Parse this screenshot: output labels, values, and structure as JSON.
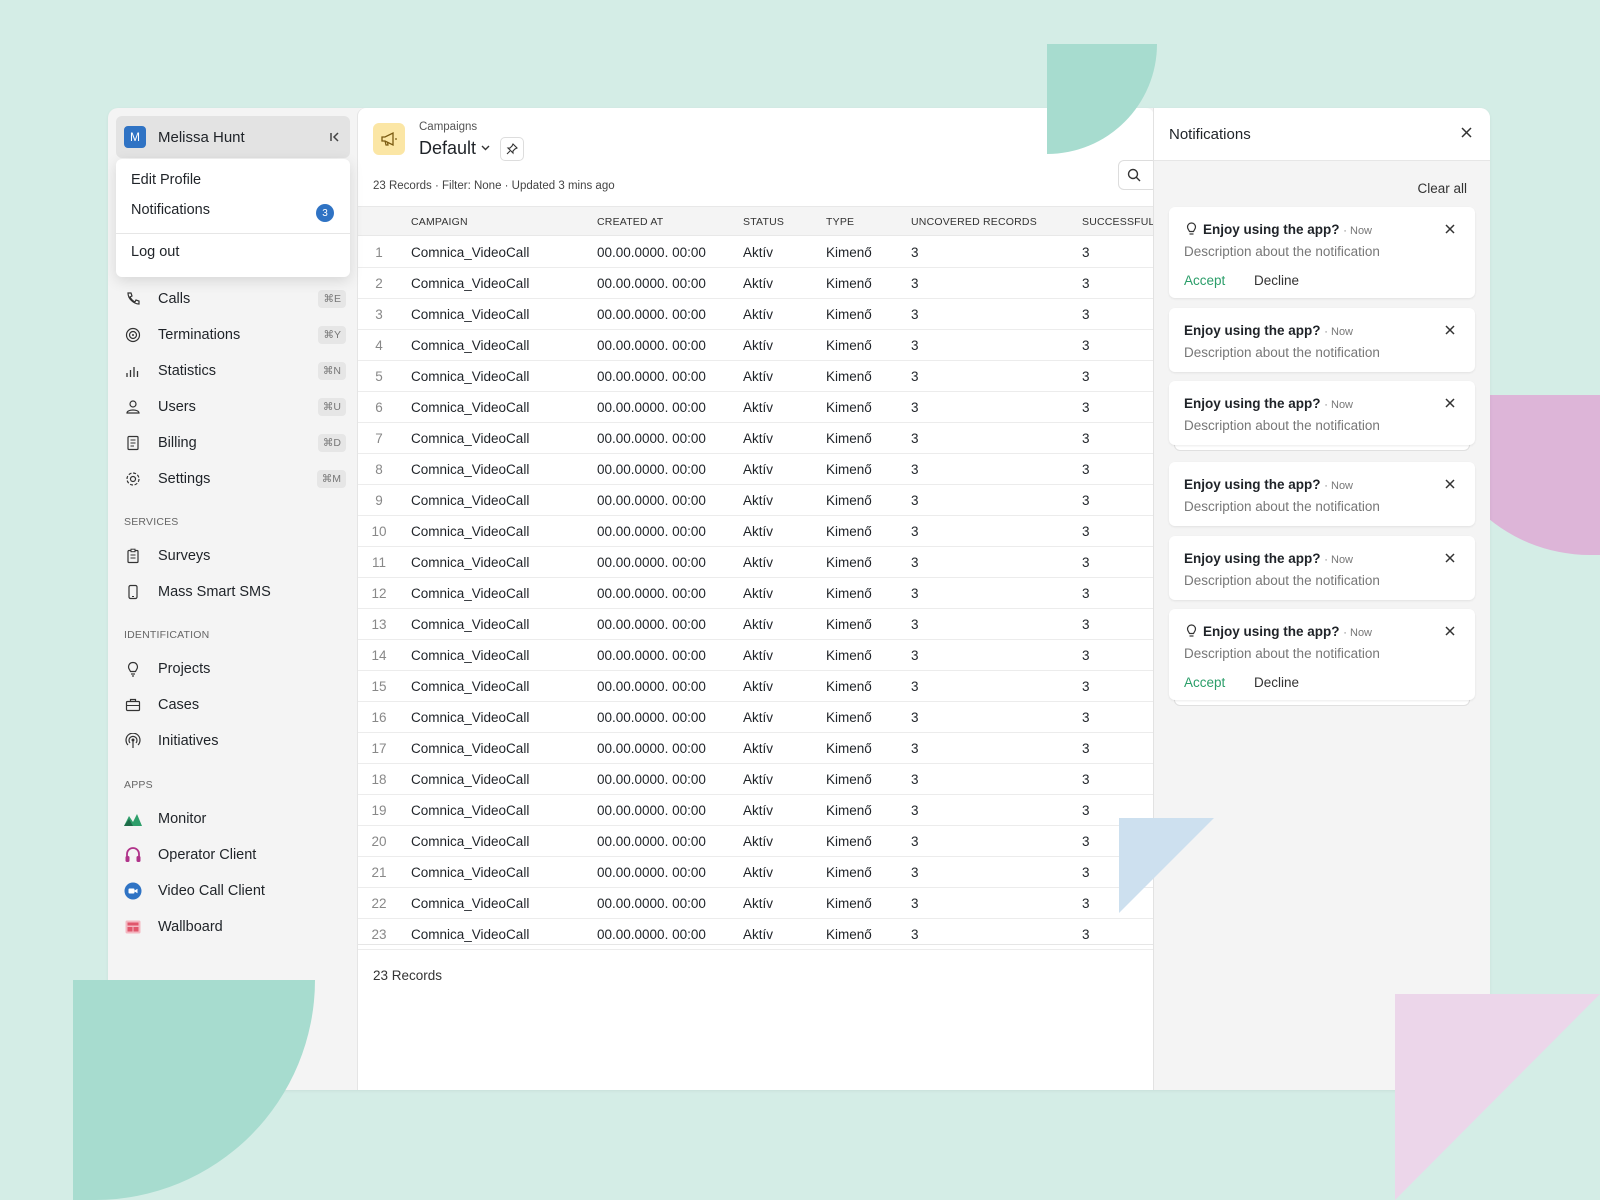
{
  "user": {
    "initial": "M",
    "name": "Melissa Hunt"
  },
  "menu": {
    "edit_profile": "Edit Profile",
    "notifications": "Notifications",
    "notifications_count": "3",
    "logout": "Log out"
  },
  "nav": [
    {
      "label": "Calls",
      "kbd": "⌘E",
      "icon": "phone-icon"
    },
    {
      "label": "Terminations",
      "kbd": "⌘Y",
      "icon": "target-icon"
    },
    {
      "label": "Statistics",
      "kbd": "⌘N",
      "icon": "bar-chart-icon"
    },
    {
      "label": "Users",
      "kbd": "⌘U",
      "icon": "user-icon"
    },
    {
      "label": "Billing",
      "kbd": "⌘D",
      "icon": "document-icon"
    },
    {
      "label": "Settings",
      "kbd": "⌘M",
      "icon": "gear-icon"
    }
  ],
  "sections": {
    "services": "SERVICES",
    "identification": "IDENTIFICATION",
    "apps": "APPS"
  },
  "services": [
    {
      "label": "Surveys",
      "icon": "clipboard-icon"
    },
    {
      "label": "Mass Smart SMS",
      "icon": "mobile-icon"
    }
  ],
  "identification": [
    {
      "label": "Projects",
      "icon": "lightbulb-icon"
    },
    {
      "label": "Cases",
      "icon": "briefcase-icon"
    },
    {
      "label": "Initiatives",
      "icon": "broadcast-icon"
    }
  ],
  "apps": [
    {
      "label": "Monitor",
      "icon": "monitor-app-icon",
      "color": "#2e9e6a"
    },
    {
      "label": "Operator Client",
      "icon": "headset-icon",
      "color": "#b0338a"
    },
    {
      "label": "Video Call Client",
      "icon": "video-icon",
      "color": "#2f73c4"
    },
    {
      "label": "Wallboard",
      "icon": "wallboard-icon",
      "color": "#e0566b"
    }
  ],
  "main": {
    "breadcrumb": "Campaigns",
    "title": "Default",
    "meta": "23 Records · Filter: None · Updated 3 mins ago",
    "footer": "23 Records"
  },
  "table": {
    "headers": [
      "CAMPAIGN",
      "CREATED AT",
      "STATUS",
      "TYPE",
      "UNCOVERED RECORDS",
      "SUCCESSFUL"
    ],
    "rows": [
      [
        "1",
        "Comnica_VideoCall",
        "00.00.0000. 00:00",
        "Aktív",
        "Kimenő",
        "3",
        "3"
      ],
      [
        "2",
        "Comnica_VideoCall",
        "00.00.0000. 00:00",
        "Aktív",
        "Kimenő",
        "3",
        "3"
      ],
      [
        "3",
        "Comnica_VideoCall",
        "00.00.0000. 00:00",
        "Aktív",
        "Kimenő",
        "3",
        "3"
      ],
      [
        "4",
        "Comnica_VideoCall",
        "00.00.0000. 00:00",
        "Aktív",
        "Kimenő",
        "3",
        "3"
      ],
      [
        "5",
        "Comnica_VideoCall",
        "00.00.0000. 00:00",
        "Aktív",
        "Kimenő",
        "3",
        "3"
      ],
      [
        "6",
        "Comnica_VideoCall",
        "00.00.0000. 00:00",
        "Aktív",
        "Kimenő",
        "3",
        "3"
      ],
      [
        "7",
        "Comnica_VideoCall",
        "00.00.0000. 00:00",
        "Aktív",
        "Kimenő",
        "3",
        "3"
      ],
      [
        "8",
        "Comnica_VideoCall",
        "00.00.0000. 00:00",
        "Aktív",
        "Kimenő",
        "3",
        "3"
      ],
      [
        "9",
        "Comnica_VideoCall",
        "00.00.0000. 00:00",
        "Aktív",
        "Kimenő",
        "3",
        "3"
      ],
      [
        "10",
        "Comnica_VideoCall",
        "00.00.0000. 00:00",
        "Aktív",
        "Kimenő",
        "3",
        "3"
      ],
      [
        "11",
        "Comnica_VideoCall",
        "00.00.0000. 00:00",
        "Aktív",
        "Kimenő",
        "3",
        "3"
      ],
      [
        "12",
        "Comnica_VideoCall",
        "00.00.0000. 00:00",
        "Aktív",
        "Kimenő",
        "3",
        "3"
      ],
      [
        "13",
        "Comnica_VideoCall",
        "00.00.0000. 00:00",
        "Aktív",
        "Kimenő",
        "3",
        "3"
      ],
      [
        "14",
        "Comnica_VideoCall",
        "00.00.0000. 00:00",
        "Aktív",
        "Kimenő",
        "3",
        "3"
      ],
      [
        "15",
        "Comnica_VideoCall",
        "00.00.0000. 00:00",
        "Aktív",
        "Kimenő",
        "3",
        "3"
      ],
      [
        "16",
        "Comnica_VideoCall",
        "00.00.0000. 00:00",
        "Aktív",
        "Kimenő",
        "3",
        "3"
      ],
      [
        "17",
        "Comnica_VideoCall",
        "00.00.0000. 00:00",
        "Aktív",
        "Kimenő",
        "3",
        "3"
      ],
      [
        "18",
        "Comnica_VideoCall",
        "00.00.0000. 00:00",
        "Aktív",
        "Kimenő",
        "3",
        "3"
      ],
      [
        "19",
        "Comnica_VideoCall",
        "00.00.0000. 00:00",
        "Aktív",
        "Kimenő",
        "3",
        "3"
      ],
      [
        "20",
        "Comnica_VideoCall",
        "00.00.0000. 00:00",
        "Aktív",
        "Kimenő",
        "3",
        "3"
      ],
      [
        "21",
        "Comnica_VideoCall",
        "00.00.0000. 00:00",
        "Aktív",
        "Kimenő",
        "3",
        "3"
      ],
      [
        "22",
        "Comnica_VideoCall",
        "00.00.0000. 00:00",
        "Aktív",
        "Kimenő",
        "3",
        "3"
      ],
      [
        "23",
        "Comnica_VideoCall",
        "00.00.0000. 00:00",
        "Aktív",
        "Kimenő",
        "3",
        "3"
      ]
    ]
  },
  "notifications": {
    "title": "Notifications",
    "clear_all": "Clear all",
    "items": [
      {
        "title": "Enjoy using the app?",
        "time": "· Now",
        "desc": "Description about the notification",
        "bulb": true,
        "actions": true,
        "accept": "Accept",
        "decline": "Decline"
      },
      {
        "title": "Enjoy using the app?",
        "time": "· Now",
        "desc": "Description about the notification",
        "bulb": false,
        "actions": false
      },
      {
        "title": "Enjoy using the app?",
        "time": "· Now",
        "desc": "Description about the notification",
        "bulb": false,
        "actions": false,
        "stacked": true
      },
      {
        "title": "Enjoy using the app?",
        "time": "· Now",
        "desc": "Description about the notification",
        "bulb": false,
        "actions": false
      },
      {
        "title": "Enjoy using the app?",
        "time": "· Now",
        "desc": "Description about the notification",
        "bulb": false,
        "actions": false
      },
      {
        "title": "Enjoy using the app?",
        "time": "· Now",
        "desc": "Description about the notification",
        "bulb": true,
        "actions": true,
        "stacked": true,
        "accept": "Accept",
        "decline": "Decline"
      }
    ]
  },
  "colors": {
    "accent": "#2f73c4",
    "accept": "#2c9e6a",
    "campaign_icon_bg": "#fbe6a5"
  }
}
